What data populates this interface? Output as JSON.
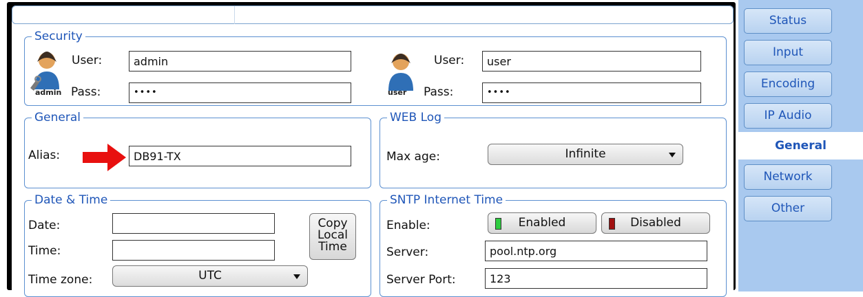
{
  "security": {
    "legend": "Security",
    "admin": {
      "avatar_caption": "admin",
      "user_label": "User:",
      "user_value": "admin",
      "pass_label": "Pass:",
      "pass_value": "••••"
    },
    "user": {
      "avatar_caption": "user",
      "user_label": "User:",
      "user_value": "user",
      "pass_label": "Pass:",
      "pass_value": "••••"
    }
  },
  "general": {
    "legend": "General",
    "alias_label": "Alias:",
    "alias_value": "DB91-TX"
  },
  "weblog": {
    "legend": "WEB Log",
    "max_age_label": "Max age:",
    "max_age_value": "Infinite"
  },
  "datetime": {
    "legend": "Date & Time",
    "date_label": "Date:",
    "date_value": "",
    "time_label": "Time:",
    "time_value": "",
    "timezone_label": "Time zone:",
    "timezone_value": "UTC",
    "copy_button": {
      "line1": "Copy",
      "line2": "Local",
      "line3": "Time"
    }
  },
  "sntp": {
    "legend": "SNTP Internet Time",
    "enable_label": "Enable:",
    "enabled_button": "Enabled",
    "disabled_button": "Disabled",
    "server_label": "Server:",
    "server_value": "pool.ntp.org",
    "port_label": "Server Port:",
    "port_value": "123"
  },
  "tabs": [
    {
      "label": "Status"
    },
    {
      "label": "Input"
    },
    {
      "label": "Encoding"
    },
    {
      "label": "IP Audio"
    },
    {
      "label": "General",
      "active": true
    },
    {
      "label": "Network"
    },
    {
      "label": "Other"
    }
  ],
  "colors": {
    "accent": "#1f56b8",
    "sidebar": "#a9c9ef",
    "enabled_led": "#2ecc40",
    "disabled_led": "#a01010",
    "arrow": "#e8100f"
  }
}
